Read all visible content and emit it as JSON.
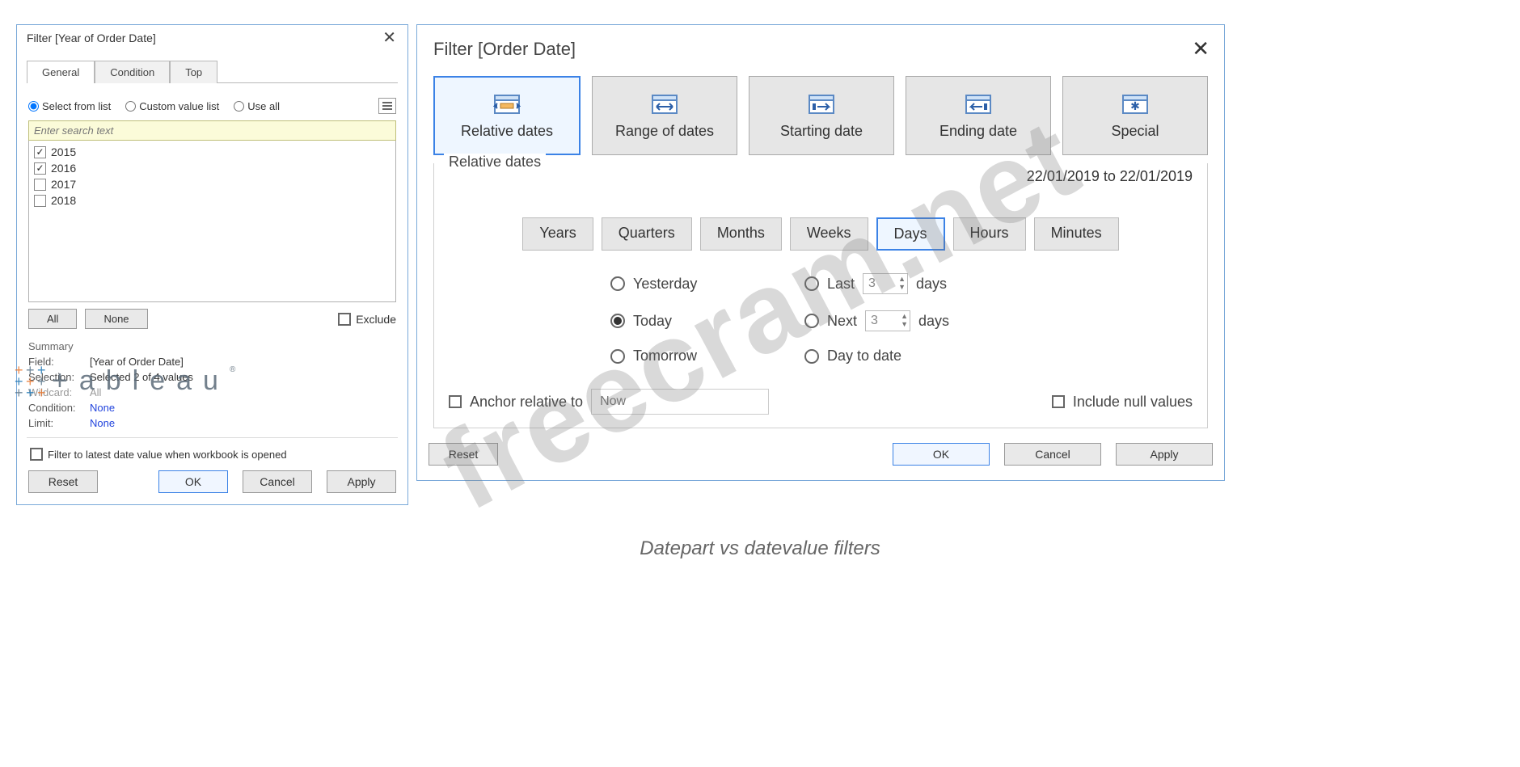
{
  "caption": "Datepart vs datevalue filters",
  "watermark_text": "freecram.net",
  "watermark_tableau": "+ableau",
  "left": {
    "title": "Filter [Year of Order Date]",
    "tabs": {
      "general": "General",
      "condition": "Condition",
      "top": "Top"
    },
    "radios": {
      "select_from_list": "Select from list",
      "custom_value_list": "Custom value list",
      "use_all": "Use all"
    },
    "search_placeholder": "Enter search text",
    "years": [
      {
        "label": "2015",
        "checked": true
      },
      {
        "label": "2016",
        "checked": true
      },
      {
        "label": "2017",
        "checked": false
      },
      {
        "label": "2018",
        "checked": false
      }
    ],
    "buttons": {
      "all": "All",
      "none": "None"
    },
    "exclude_label": "Exclude",
    "summary": {
      "header": "Summary",
      "field_k": "Field:",
      "field_v": "[Year of Order Date]",
      "selection_k": "Selection:",
      "selection_v": "Selected 2 of 4 values",
      "wildcard_k": "Wildcard:",
      "wildcard_v": "All",
      "condition_k": "Condition:",
      "condition_v": "None",
      "limit_k": "Limit:",
      "limit_v": "None"
    },
    "filter_latest": "Filter to latest date value when workbook is opened",
    "footer": {
      "reset": "Reset",
      "ok": "OK",
      "cancel": "Cancel",
      "apply": "Apply"
    }
  },
  "right": {
    "title": "Filter [Order Date]",
    "modes": {
      "relative": "Relative dates",
      "range": "Range of dates",
      "starting": "Starting date",
      "ending": "Ending date",
      "special": "Special"
    },
    "panel_legend": "Relative dates",
    "date_range": "22/01/2019 to 22/01/2019",
    "units": {
      "years": "Years",
      "quarters": "Quarters",
      "months": "Months",
      "weeks": "Weeks",
      "days": "Days",
      "hours": "Hours",
      "minutes": "Minutes"
    },
    "options": {
      "yesterday": "Yesterday",
      "today": "Today",
      "tomorrow": "Tomorrow",
      "last": "Last",
      "next": "Next",
      "day_to_date": "Day to date",
      "last_n": "3",
      "next_n": "3",
      "unit_word": "days"
    },
    "anchor": {
      "label": "Anchor relative to",
      "placeholder": "Now",
      "include_null": "Include null values"
    },
    "footer": {
      "reset": "Reset",
      "ok": "OK",
      "cancel": "Cancel",
      "apply": "Apply"
    }
  }
}
